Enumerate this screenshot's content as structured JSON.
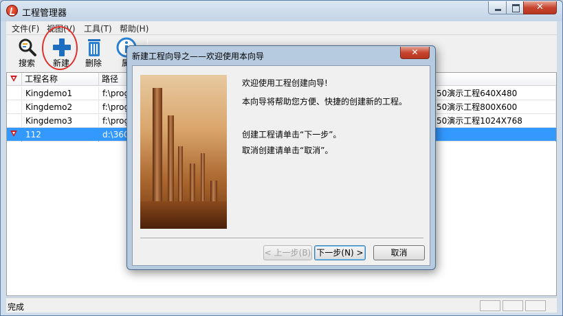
{
  "window": {
    "title": "工程管理器",
    "close_label": "✕"
  },
  "menu": [
    {
      "label": "文件(F)"
    },
    {
      "label": "视图(V)"
    },
    {
      "label": "工具(T)"
    },
    {
      "label": "帮助(H)"
    }
  ],
  "toolbar": {
    "items": [
      {
        "label": "搜索",
        "icon": "search-icon"
      },
      {
        "label": "新建",
        "icon": "add-icon"
      },
      {
        "label": "删除",
        "icon": "trash-icon"
      },
      {
        "label": "属",
        "icon": "info-icon"
      }
    ]
  },
  "grid": {
    "columns": [
      "工程名称",
      "路径"
    ],
    "rows": [
      {
        "name": "Kingdemo1",
        "path": "f:\\prog",
        "desc": "50演示工程640X480",
        "flag": false,
        "selected": false
      },
      {
        "name": "Kingdemo2",
        "path": "f:\\prog",
        "desc": "50演示工程800X600",
        "flag": false,
        "selected": false
      },
      {
        "name": "Kingdemo3",
        "path": "f:\\prog",
        "desc": "50演示工程1024X768",
        "flag": false,
        "selected": false
      },
      {
        "name": "112",
        "path": "d:\\360",
        "desc": "",
        "flag": true,
        "selected": true
      }
    ]
  },
  "status": {
    "text": "完成"
  },
  "dialog": {
    "title": "新建工程向导之——欢迎使用本向导",
    "close_label": "✕",
    "messages": [
      "欢迎使用工程创建向导!",
      "本向导将帮助您方便、快捷的创建新的工程。",
      "创建工程请单击“下一步”。",
      "取消创建请单击“取消”。"
    ],
    "back_label": "< 上一步(B)",
    "next_label": "下一步(N) >",
    "cancel_label": "取消"
  },
  "colors": {
    "selection": "#3399ff",
    "annotation_circle": "#e0302a",
    "close_button": "#c7452f"
  }
}
